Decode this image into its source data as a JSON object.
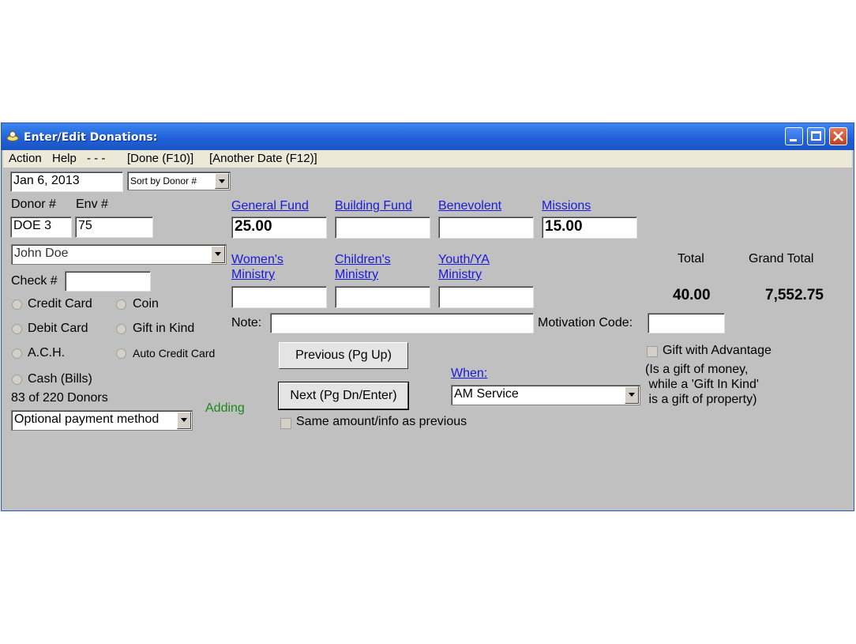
{
  "window": {
    "title": "Enter/Edit Donations:"
  },
  "menu": [
    "Action",
    "Help",
    "- - -",
    "[Done (F10)]",
    "[Another Date (F12)]"
  ],
  "date": "Jan 6, 2013",
  "sort": "Sort by Donor #",
  "donor": {
    "donor_label": "Donor #",
    "env_label": "Env #",
    "donor_value": "DOE  3",
    "env_value": "75",
    "name": "John Doe"
  },
  "check_label": "Check #",
  "check_value": "",
  "payment_methods": [
    "Credit Card",
    "Coin",
    "Debit Card",
    "Gift in Kind",
    "A.C.H.",
    "Auto Credit Card",
    "Cash (Bills)"
  ],
  "donor_count": "83 of 220 Donors",
  "status": "Adding",
  "optional_payment": "Optional payment method",
  "funds": [
    {
      "name": "General Fund",
      "value": "25.00"
    },
    {
      "name": "Building Fund",
      "value": ""
    },
    {
      "name": "Benevolent",
      "value": ""
    },
    {
      "name": "Missions",
      "value": "15.00"
    },
    {
      "name_line1": "Women's ",
      "name_line2": "Ministry",
      "value": ""
    },
    {
      "name_line1": "Children's ",
      "name_line2": "Ministry",
      "value": ""
    },
    {
      "name_line1": "Youth/YA ",
      "name_line2": "Ministry",
      "value": ""
    }
  ],
  "totals": {
    "total_label": "Total",
    "grand_label": "Grand Total",
    "total": "40.00",
    "grand_total": "7,552.75"
  },
  "note_label": "Note:",
  "note_value": "",
  "motivation_label": "Motivation Code:",
  "motivation_value": "",
  "buttons": {
    "previous": "Previous (Pg Up)",
    "next": "Next (Pg Dn/Enter)"
  },
  "when": {
    "label": "When:",
    "value": "AM Service"
  },
  "same_amount": "Same amount/info as previous",
  "gift_advantage": {
    "label": "Gift with Advantage",
    "line1": "(Is a gift of money,",
    "line2": " while a 'Gift In Kind'",
    "line3": " is a gift of property)"
  },
  "colors": {
    "title_bar": "#2a62d8",
    "window_bg": "#c0c0c0",
    "link": "#1a1adc",
    "status": "#1c8a1c"
  }
}
